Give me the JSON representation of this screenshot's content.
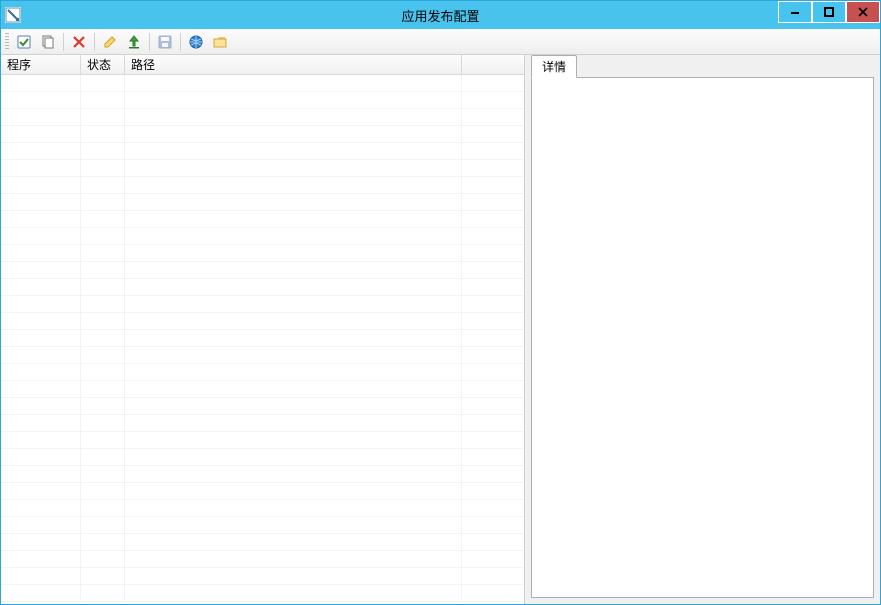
{
  "window": {
    "title": "应用发布配置"
  },
  "toolbar": {
    "icons": {
      "checklist": "checklist-icon",
      "copy": "copy-icon",
      "delete": "delete-icon",
      "edit": "edit-icon",
      "publish": "upload-icon",
      "save": "save-icon",
      "globe": "globe-icon",
      "folder": "folder-icon"
    }
  },
  "table": {
    "columns": {
      "program": "程序",
      "status": "状态",
      "path": "路径",
      "extra": ""
    },
    "rows": []
  },
  "details": {
    "tab_label": "详情"
  }
}
